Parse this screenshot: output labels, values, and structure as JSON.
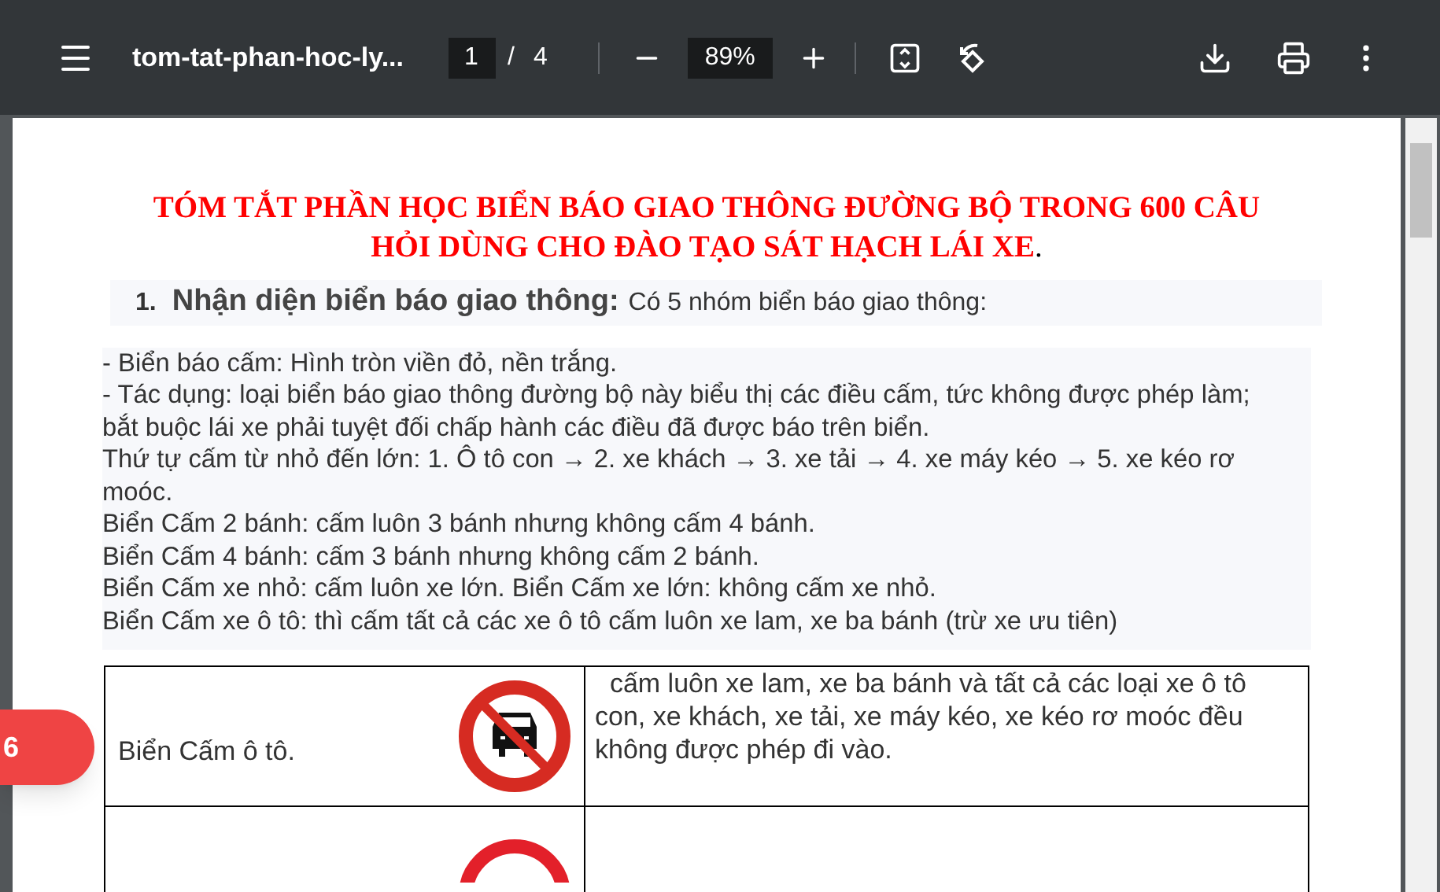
{
  "toolbar": {
    "title": "tom-tat-phan-hoc-ly...",
    "page_input": {
      "value": "1"
    },
    "page_separator": "/",
    "page_count": "4",
    "zoom": "89%"
  },
  "document": {
    "title": "TÓM TẮT PHẦN HỌC BIỂN BÁO GIAO THÔNG ĐƯỜNG BỘ TRONG 600 CÂU HỎI DÙNG CHO ĐÀO TẠO SÁT HẠCH LÁI XE",
    "title_end": ".",
    "heading": {
      "number": "1.",
      "label": "Nhận diện biển báo giao thông:",
      "text": "Có 5 nhóm biển báo giao thông:"
    },
    "paragraphs": [
      "- Biển báo cấm: Hình tròn viền đỏ, nền trắng.",
      "- Tác dụng: loại biển báo giao thông đường bộ này biểu thị các điều cấm, tức không được phép làm; bắt buộc lái xe phải tuyệt đối chấp hành các điều đã được báo trên biển.",
      "Thứ tự cấm từ nhỏ đến lớn: 1. Ô tô con → 2. xe khách → 3. xe tải → 4. xe máy kéo → 5. xe kéo rơ moóc.",
      "Biển Cấm 2 bánh: cấm luôn 3 bánh nhưng không cấm 4 bánh.",
      "Biển Cấm 4 bánh: cấm 3 bánh nhưng không cấm 2 bánh.",
      "Biển Cấm xe nhỏ: cấm luôn xe lớn. Biển Cấm xe lớn: không cấm xe nhỏ.",
      "Biển Cấm xe ô tô: thì cấm tất cả các xe ô tô cấm luôn xe lam, xe ba bánh (trừ xe ưu tiên)"
    ],
    "table": {
      "rows": [
        {
          "kind": "no-car",
          "label": "Biển Cấm ô tô.",
          "description": "  cấm luôn xe lam, xe ba bánh và tất cả các loại xe ô tô con, xe khách, xe tải, xe máy kéo, xe kéo rơ moóc đều không được phép đi vào."
        },
        {
          "kind": "cut"
        }
      ]
    }
  },
  "floating_button": {
    "label": "6"
  }
}
